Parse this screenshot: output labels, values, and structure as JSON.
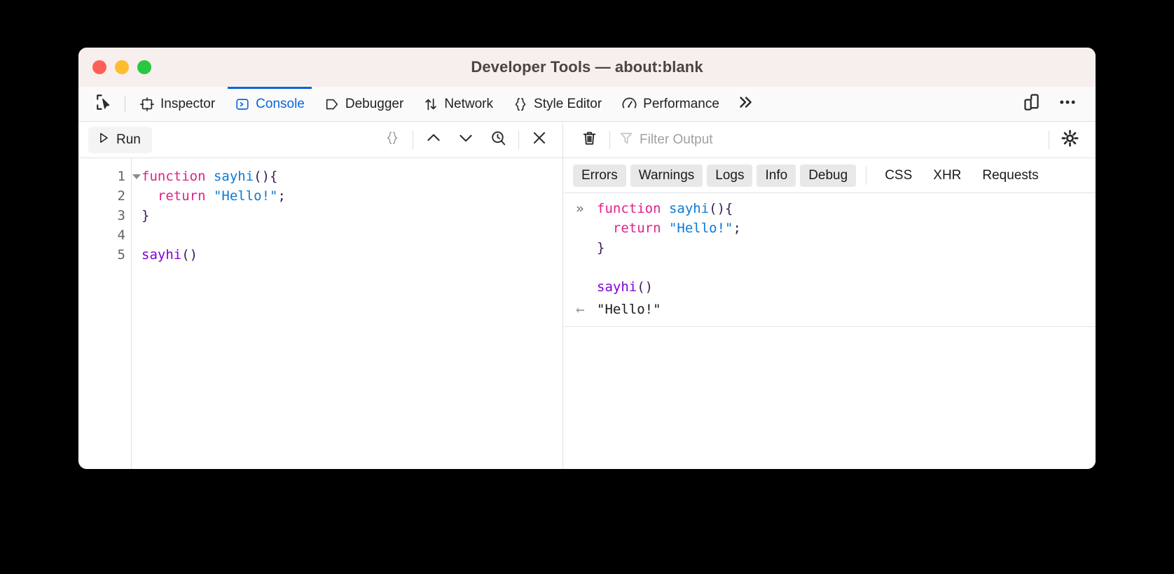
{
  "window": {
    "title": "Developer Tools — about:blank",
    "traffic_lights": [
      "close",
      "minimize",
      "maximize"
    ]
  },
  "toolbar_tabs": {
    "picker_icon": "element-picker-icon",
    "items": [
      {
        "label": "Inspector",
        "icon": "inspector-icon",
        "active": false
      },
      {
        "label": "Console",
        "icon": "console-icon",
        "active": true
      },
      {
        "label": "Debugger",
        "icon": "debugger-icon",
        "active": false
      },
      {
        "label": "Network",
        "icon": "network-icon",
        "active": false
      },
      {
        "label": "Style Editor",
        "icon": "style-editor-icon",
        "active": false
      },
      {
        "label": "Performance",
        "icon": "performance-icon",
        "active": false
      }
    ],
    "overflow_icon": "chevron-double-right-icon",
    "right_icons": [
      "responsive-design-mode-icon",
      "meatball-menu-icon"
    ]
  },
  "editor": {
    "run_label": "Run",
    "run_icon": "play-icon",
    "tools": [
      "pretty-print-icon",
      "previous-expression-icon",
      "next-expression-icon",
      "evaluation-history-icon",
      "close-editor-icon"
    ],
    "line_numbers": [
      "1",
      "2",
      "3",
      "4",
      "5"
    ],
    "lines": [
      [
        {
          "t": "function",
          "c": "kw"
        },
        {
          "t": " ",
          "c": "plain"
        },
        {
          "t": "sayhi",
          "c": "fn"
        },
        {
          "t": "(){",
          "c": "pun"
        }
      ],
      [
        {
          "t": "  ",
          "c": "plain"
        },
        {
          "t": "return",
          "c": "kw"
        },
        {
          "t": " ",
          "c": "plain"
        },
        {
          "t": "\"Hello!\"",
          "c": "str"
        },
        {
          "t": ";",
          "c": "pun"
        }
      ],
      [
        {
          "t": "}",
          "c": "pun"
        }
      ],
      [
        {
          "t": "",
          "c": "plain"
        }
      ],
      [
        {
          "t": "sayhi",
          "c": "fnp"
        },
        {
          "t": "()",
          "c": "pun"
        }
      ]
    ]
  },
  "console": {
    "clear_icon": "trash-icon",
    "filter_icon": "funnel-icon",
    "filter_placeholder": "Filter Output",
    "settings_icon": "gear-icon",
    "filters": [
      {
        "label": "Errors",
        "active": true
      },
      {
        "label": "Warnings",
        "active": true
      },
      {
        "label": "Logs",
        "active": true
      },
      {
        "label": "Info",
        "active": true
      },
      {
        "label": "Debug",
        "active": true
      },
      {
        "label": "CSS",
        "active": false
      },
      {
        "label": "XHR",
        "active": false
      },
      {
        "label": "Requests",
        "active": false
      }
    ],
    "messages": [
      {
        "type": "input",
        "marker": "»",
        "lines": [
          [
            {
              "t": "function",
              "c": "kw"
            },
            {
              "t": " ",
              "c": "plain"
            },
            {
              "t": "sayhi",
              "c": "fn"
            },
            {
              "t": "(){",
              "c": "pun"
            }
          ],
          [
            {
              "t": "  ",
              "c": "plain"
            },
            {
              "t": "return",
              "c": "kw"
            },
            {
              "t": " ",
              "c": "plain"
            },
            {
              "t": "\"Hello!\"",
              "c": "str"
            },
            {
              "t": ";",
              "c": "pun"
            }
          ],
          [
            {
              "t": "}",
              "c": "pun"
            }
          ],
          [
            {
              "t": "",
              "c": "plain"
            }
          ],
          [
            {
              "t": "sayhi",
              "c": "fnp"
            },
            {
              "t": "()",
              "c": "pun"
            }
          ]
        ]
      },
      {
        "type": "result",
        "marker": "←",
        "value": "\"Hello!\""
      }
    ]
  },
  "colors": {
    "accent": "#0a66de",
    "titlebar": "#f7efed",
    "keyword": "#e0218a",
    "function": "#0b7ad6",
    "function_call": "#8000d7",
    "string": "#0b7ad6",
    "punctuation": "#3b1a5c"
  }
}
